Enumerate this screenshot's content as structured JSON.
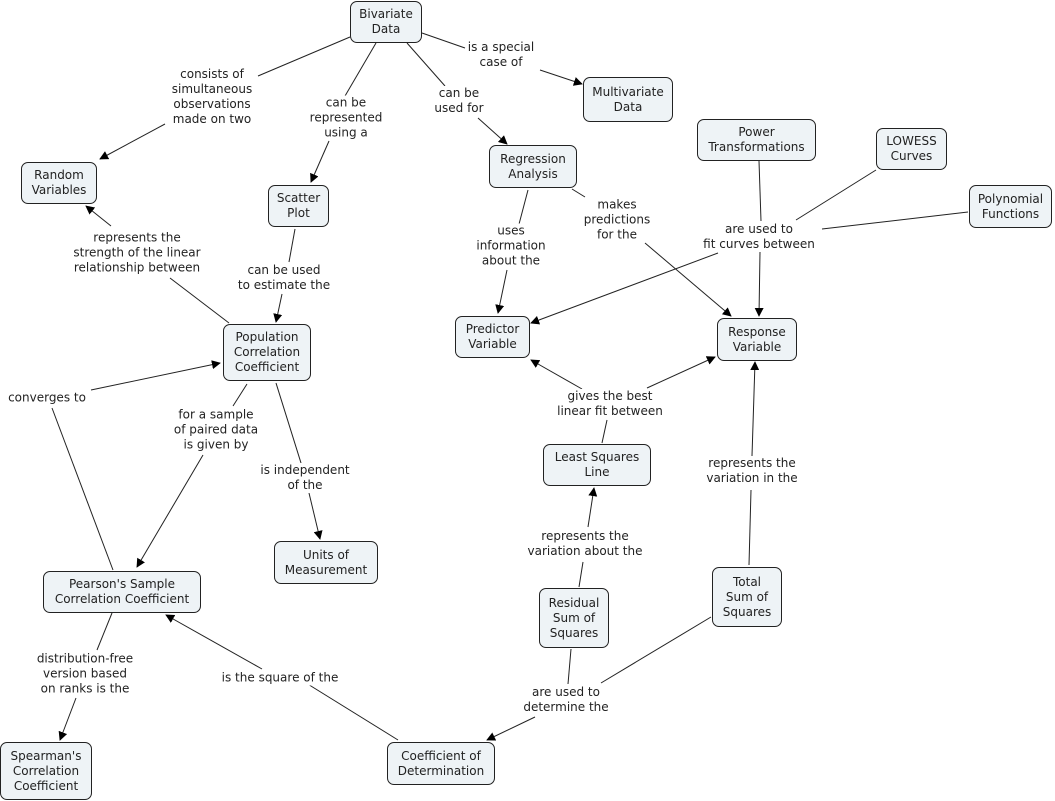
{
  "concepts": {
    "bivariate_data": "Bivariate\nData",
    "multivariate_data": "Multivariate\nData",
    "random_variables": "Random\nVariables",
    "scatter_plot": "Scatter\nPlot",
    "regression_analysis": "Regression\nAnalysis",
    "power_transformations": "Power\nTransformations",
    "lowess_curves": "LOWESS\nCurves",
    "polynomial_functions": "Polynomial\nFunctions",
    "population_correlation_coefficient": "Population\nCorrelation\nCoefficient",
    "predictor_variable": "Predictor\nVariable",
    "response_variable": "Response\nVariable",
    "least_squares_line": "Least Squares\nLine",
    "units_of_measurement": "Units of\nMeasurement",
    "pearsons_sample_correlation_coefficient": "Pearson's Sample\nCorrelation Coefficient",
    "residual_sum_of_squares": "Residual\nSum of\nSquares",
    "total_sum_of_squares": "Total\nSum of\nSquares",
    "spearmans_correlation_coefficient": "Spearman's\nCorrelation\nCoefficient",
    "coefficient_of_determination": "Coefficient of\nDetermination"
  },
  "links": {
    "is_special_case_of": "is a special\ncase of",
    "consists_of": "consists of\nsimultaneous\nobservations\nmade on two",
    "can_be_represented": "can be\nrepresented\nusing a",
    "can_be_used_for": "can be\nused for",
    "represents_strength": "represents the\nstrength of the linear\nrelationship between",
    "can_be_used_to_estimate": "can be used\nto estimate the",
    "uses_information": "uses\ninformation\nabout the",
    "makes_predictions": "makes\npredictions\nfor the",
    "are_used_to_fit": "are used to\nfit curves between",
    "converges_to": "converges to",
    "for_a_sample": "for a sample\nof paired data\nis given by",
    "is_independent": "is independent\nof the",
    "gives_best_fit": "gives the best\nlinear fit between",
    "represents_variation_in": "represents the\nvariation in the",
    "represents_variation_about": "represents the\nvariation about the",
    "distribution_free": "distribution-free\nversion based\non ranks is the",
    "is_square_of": "is the square of the",
    "are_used_to_determine": "are used to\ndetermine the"
  }
}
